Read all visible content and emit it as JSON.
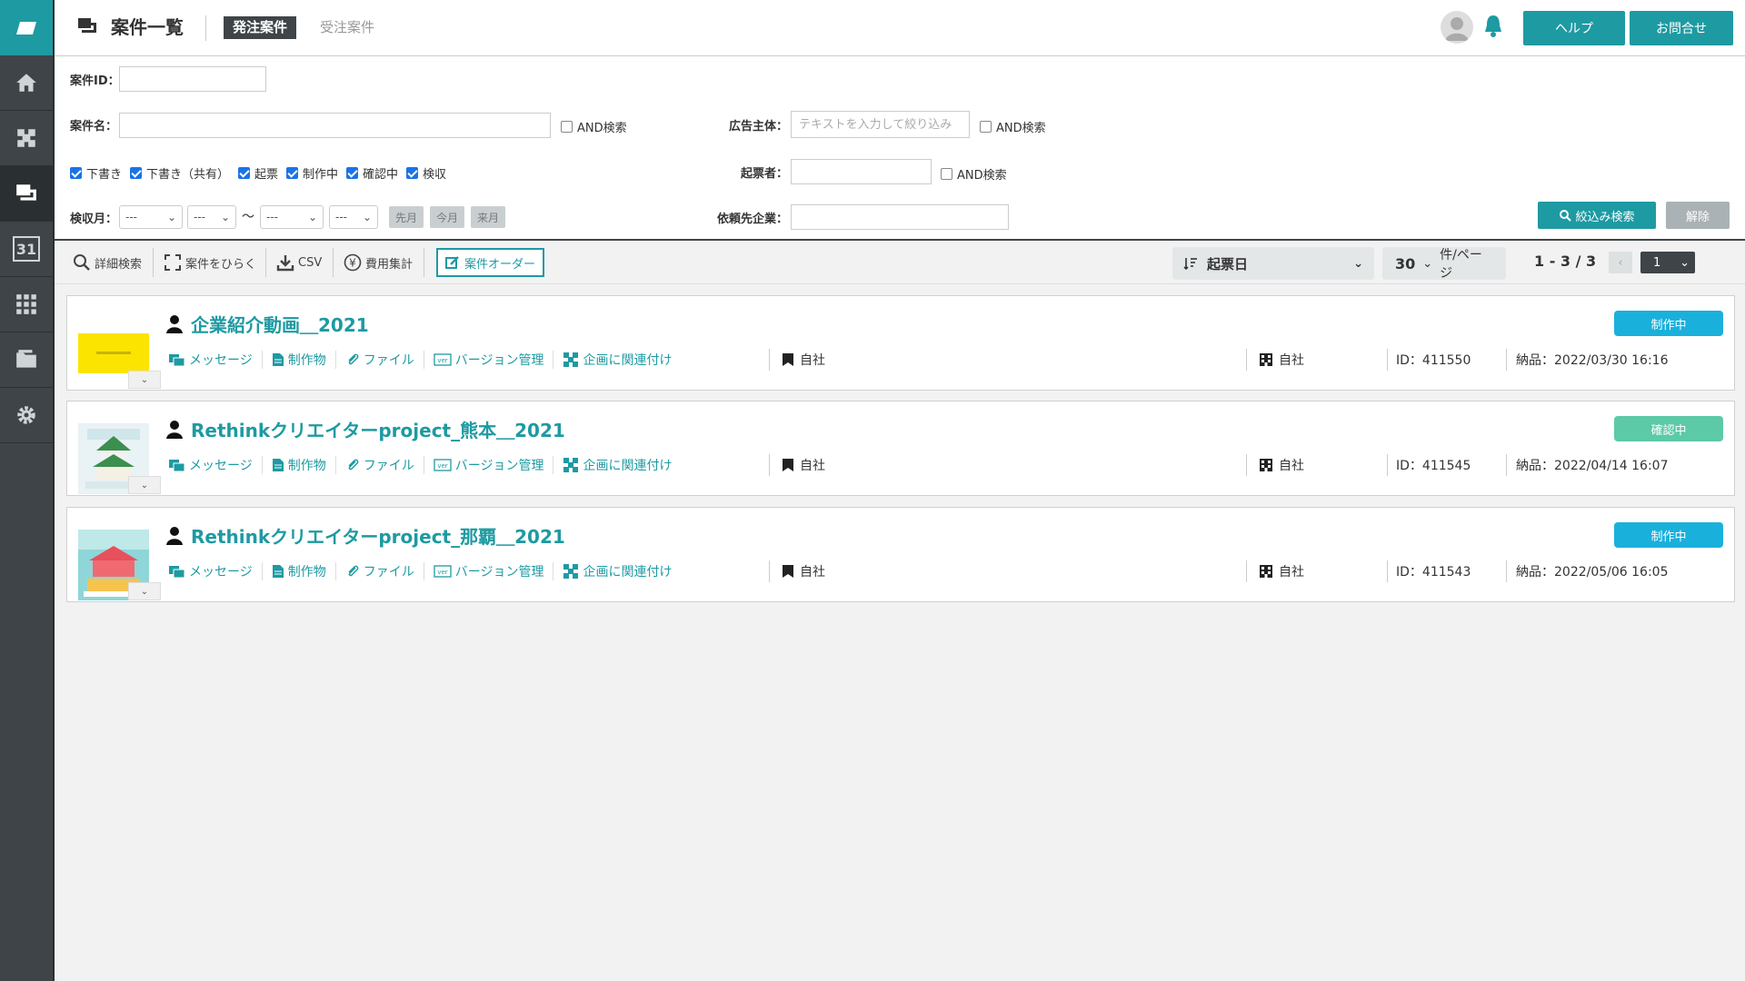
{
  "app": {
    "brand_color": "#1e9aa2"
  },
  "sidebar": {
    "items": [
      {
        "icon": "home-icon"
      },
      {
        "icon": "puzzle-icon"
      },
      {
        "icon": "projects-icon",
        "active": true
      },
      {
        "icon": "calendar-icon",
        "label": "31"
      },
      {
        "icon": "grid-icon"
      },
      {
        "icon": "folder-icon"
      },
      {
        "icon": "gear-icon"
      }
    ]
  },
  "header": {
    "title": "案件一覧",
    "tab_active": "発注案件",
    "tab_inactive": "受注案件",
    "help_label": "ヘルプ",
    "contact_label": "お問合せ"
  },
  "filters": {
    "id_label": "案件ID：",
    "name_label": "案件名：",
    "and_label": "AND検索",
    "advertiser_label": "広告主体：",
    "advertiser_placeholder": "テキストを入力して絞り込み",
    "statuses": [
      {
        "label": "下書き",
        "checked": true
      },
      {
        "label": "下書き（共有）",
        "checked": true
      },
      {
        "label": "起票",
        "checked": true
      },
      {
        "label": "制作中",
        "checked": true
      },
      {
        "label": "確認中",
        "checked": true
      },
      {
        "label": "検収",
        "checked": true
      }
    ],
    "drafter_label": "起票者：",
    "month_label": "検収月：",
    "select_placeholder": "---",
    "tilde": "〜",
    "prev_month": "先月",
    "this_month": "今月",
    "next_month": "来月",
    "client_label": "依頼先企業：",
    "search_label": "絞込み検索",
    "clear_label": "解除"
  },
  "toolbar": {
    "detail_search": "詳細検索",
    "expand_cases": "案件をひらく",
    "csv": "CSV",
    "cost_total": "費用集計",
    "case_order": "案件オーダー",
    "sort_value": "起票日",
    "per_page_value": "30",
    "per_page_unit": "件/ページ",
    "range": "1 - 3 / 3",
    "page_value": "1"
  },
  "cases": [
    {
      "title": "企業紹介動画＿2021",
      "status": "制作中",
      "status_color": "#1ab0dc",
      "advertiser": "自社",
      "client": "自社",
      "id": "ID：411550",
      "delivery": "納品：2022/03/30 16:16",
      "thumb": "yellow"
    },
    {
      "title": "Rethinkクリエイターproject_熊本＿2021",
      "status": "確認中",
      "status_color": "#5cc9a7",
      "advertiser": "自社",
      "client": "自社",
      "id": "ID：411545",
      "delivery": "納品：2022/04/14 16:07",
      "thumb": "castle"
    },
    {
      "title": "Rethinkクリエイターproject_那覇＿2021",
      "status": "制作中",
      "status_color": "#1ab0dc",
      "advertiser": "自社",
      "client": "自社",
      "id": "ID：411543",
      "delivery": "納品：2022/05/06 16:05",
      "thumb": "shuri"
    }
  ],
  "case_links": {
    "message": "メッセージ",
    "deliverable": "制作物",
    "file": "ファイル",
    "version": "バージョン管理",
    "link_plan": "企画に関連付け"
  }
}
